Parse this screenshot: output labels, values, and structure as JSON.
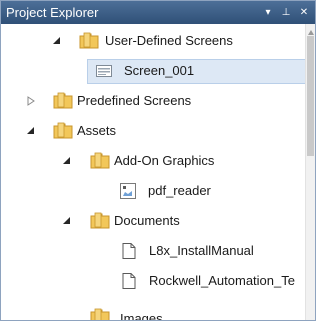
{
  "panel": {
    "title": "Project Explorer",
    "dropdown_glyph": "▾",
    "pin_glyph": "⊥",
    "close_glyph": "✕"
  },
  "tree": {
    "items": [
      {
        "label": "User-Defined Screens",
        "kind": "folder",
        "expanded": true
      },
      {
        "label": "Screen_001",
        "kind": "screen",
        "selected": true
      },
      {
        "label": "Predefined Screens",
        "kind": "folder",
        "expanded": false
      },
      {
        "label": "Assets",
        "kind": "folder",
        "expanded": true
      },
      {
        "label": "Add-On Graphics",
        "kind": "folder",
        "expanded": true
      },
      {
        "label": "pdf_reader",
        "kind": "image"
      },
      {
        "label": "Documents",
        "kind": "folder",
        "expanded": true
      },
      {
        "label": "L8x_InstallManual",
        "kind": "document"
      },
      {
        "label": "Rockwell_Automation_Te",
        "kind": "document"
      },
      {
        "label": "Images",
        "kind": "folder",
        "expanded": false
      }
    ]
  },
  "colors": {
    "title_bar": "#3b5c84",
    "selection": "#dde8f5",
    "folder": "#e8b64a"
  }
}
